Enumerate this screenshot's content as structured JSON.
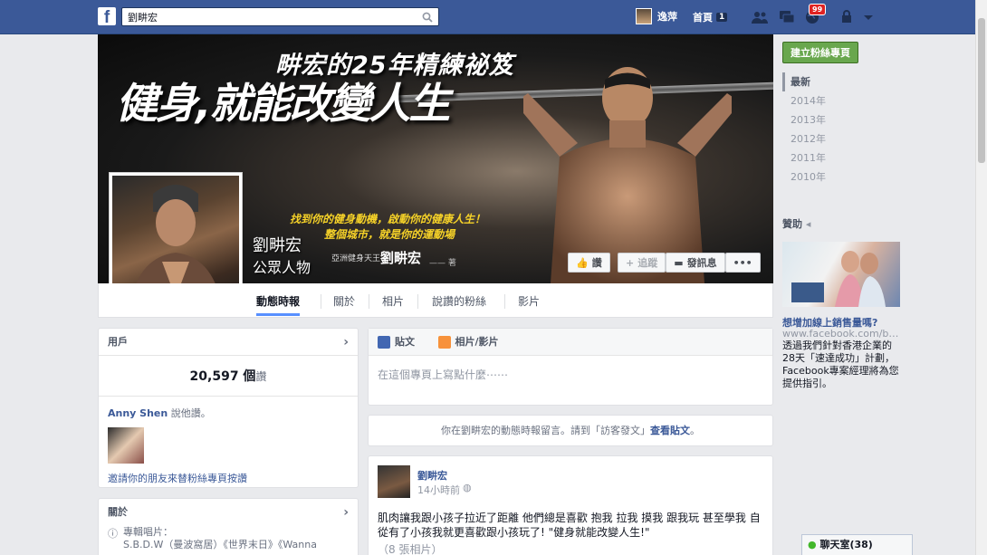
{
  "topbar": {
    "search_value": "劉畊宏",
    "user_name": "逸萍",
    "home_label": "首頁",
    "home_count": "1",
    "notif_count": "99"
  },
  "cover": {
    "headline_small": "畊宏的25年精練祕笈",
    "headline_big": "健身,就能改變人生",
    "tagline1": "找到你的健身動機，啟動你的健康人生！",
    "tagline2": "整個城市，就是你的運動場",
    "author_prefix": "亞洲健身天王",
    "author_name": "劉畊宏",
    "author_suffix": "—— 著"
  },
  "profile": {
    "name": "劉畊宏",
    "category": "公眾人物"
  },
  "cover_buttons": {
    "like": "讚",
    "follow": "追蹤",
    "message": "發訊息",
    "more": "•••"
  },
  "tabs": [
    "動態時報",
    "關於",
    "相片",
    "說讚的粉絲",
    "影片"
  ],
  "likes_card": {
    "header": "用戶",
    "count": "20,597 個",
    "unit": "讚",
    "friend_name": "Anny Shen",
    "friend_text": "說他讚。",
    "invite_link": "邀請你的朋友來替粉絲專頁按讚"
  },
  "about_card": {
    "header": "關於",
    "line1": "專輯唱片：",
    "line2": "S.B.D.W（曼波窩居）《世界末日》《Wanna"
  },
  "composer": {
    "tab_post": "貼文",
    "tab_photo": "相片/影片",
    "placeholder": "在這個專頁上寫點什麼⋯⋯"
  },
  "notice": {
    "text": "你在劉畊宏的動態時報留言。請到「訪客發文」",
    "link": "查看貼文",
    "end": "。"
  },
  "post": {
    "author": "劉畊宏",
    "time": "14小時前",
    "body": "肌肉讓我跟小孩子拉近了距離 他們總是喜歡 抱我 拉我 摸我 跟我玩 甚至學我 自從有了小孩我就更喜歡跟小孩玩了! \"健身就能改變人生!\"",
    "photos": "（8 張相片）"
  },
  "sidebar": {
    "create_page": "建立粉絲專頁",
    "years": [
      "最新",
      "2014年",
      "2013年",
      "2012年",
      "2011年",
      "2010年"
    ],
    "sponsored": "贊助",
    "ad_title": "想增加線上銷售量嗎?",
    "ad_url": "www.facebook.com/business",
    "ad_body": "透過我們針對香港企業的28天「速達成功」計劃，Facebook專案經理將為您提供指引。"
  },
  "chat": {
    "label": "聊天室(38)"
  },
  "colors": {
    "brand": "#3b5998",
    "accent_tab": "#5890ff",
    "green_button": "#69a74e",
    "badge": "#e02222"
  }
}
